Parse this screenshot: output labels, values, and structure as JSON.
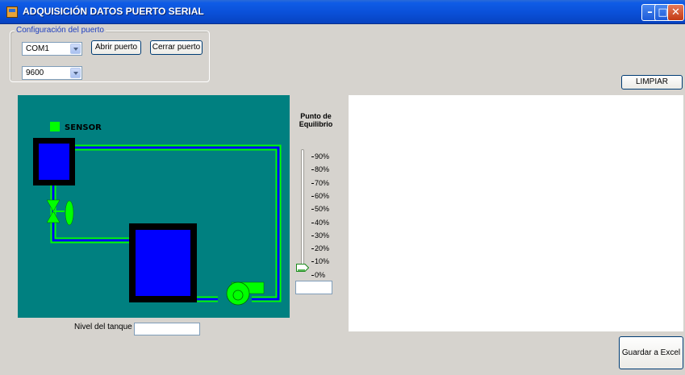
{
  "window": {
    "title": "ADQUISICIÓN DATOS PUERTO SERIAL",
    "controls": [
      "minimize",
      "maximize",
      "close"
    ]
  },
  "port_config": {
    "legend": "Configuración del puerto",
    "port_value": "COM1",
    "baud_value": "9600",
    "open_label": "Abrir puerto",
    "close_label": "Cerrar puerto"
  },
  "buttons": {
    "clear_label": "LIMPIAR",
    "save_excel_label": "Guardar a Excel"
  },
  "diagram": {
    "sensor_label": "SENSOR",
    "colors": {
      "background": "#008080",
      "tank": "#0000ff",
      "pipe": "#0000ff",
      "pipe_outline": "#00ff00",
      "sensor": "#00ff00",
      "valve": "#00ff00",
      "pump": "#00ff00"
    }
  },
  "tank_level": {
    "label": "Nivel del tanque",
    "value": ""
  },
  "setpoint": {
    "title_line1": "Punto de",
    "title_line2": "Equilibrio",
    "ticks": [
      "90%",
      "80%",
      "70%",
      "60%",
      "50%",
      "40%",
      "30%",
      "20%",
      "10%",
      "0%"
    ],
    "slider_value_percent": 0,
    "value_box": ""
  }
}
